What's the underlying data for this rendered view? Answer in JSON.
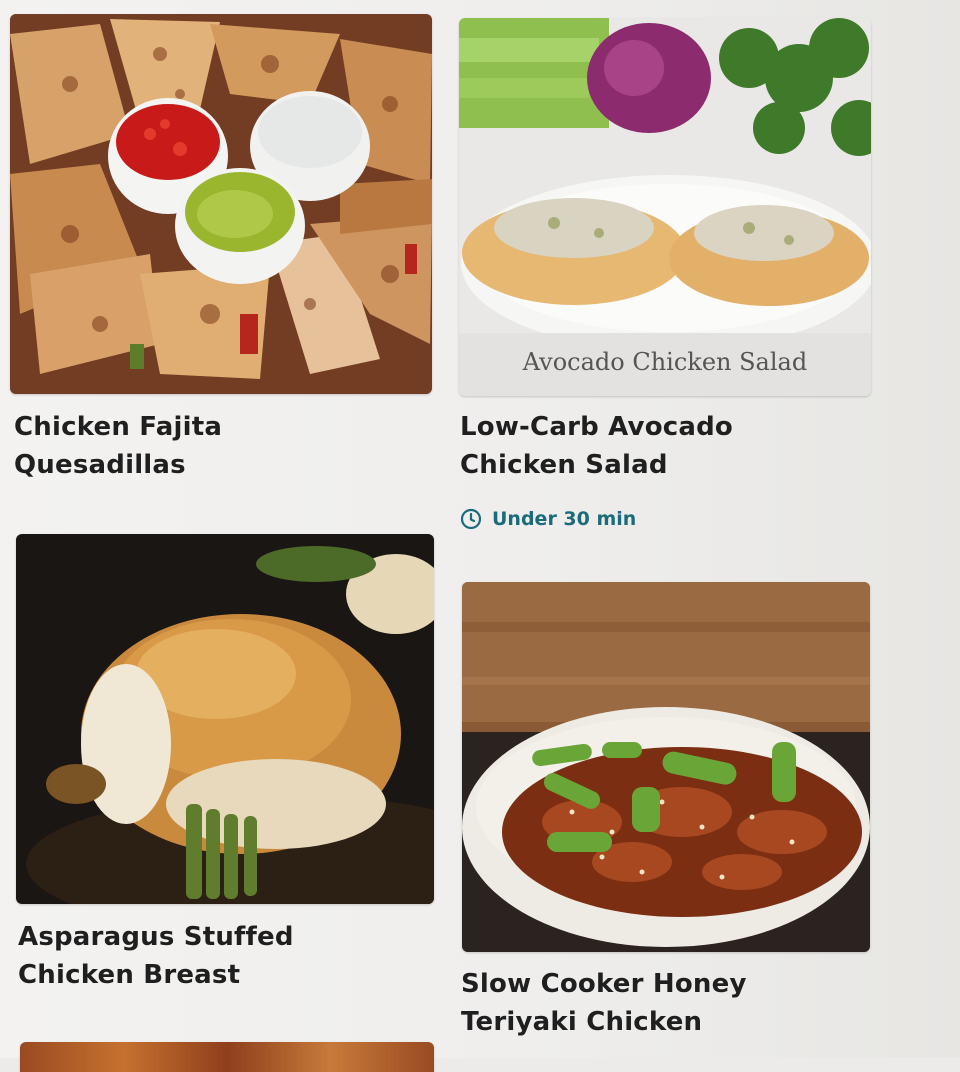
{
  "recipes": [
    {
      "title_line1": "Chicken Fajita",
      "title_line2": "Quesadillas",
      "image": "chicken-fajita-quesadillas-photo"
    },
    {
      "title_line1": "Low-Carb Avocado",
      "title_line2": "Chicken Salad",
      "image": "avocado-chicken-salad-photo",
      "image_caption": "Avocado Chicken Salad",
      "time_label": "Under 30 min",
      "time_icon": "clock-icon"
    },
    {
      "title_line1": "Asparagus Stuffed",
      "title_line2": "Chicken Breast",
      "image": "asparagus-stuffed-chicken-photo"
    },
    {
      "title_line1": "Slow Cooker Honey",
      "title_line2": "Teriyaki Chicken",
      "image": "honey-teriyaki-chicken-photo"
    }
  ],
  "colors": {
    "title": "#1f1f1f",
    "meta_accent": "#1b6b7a",
    "background": "#efeeed"
  }
}
